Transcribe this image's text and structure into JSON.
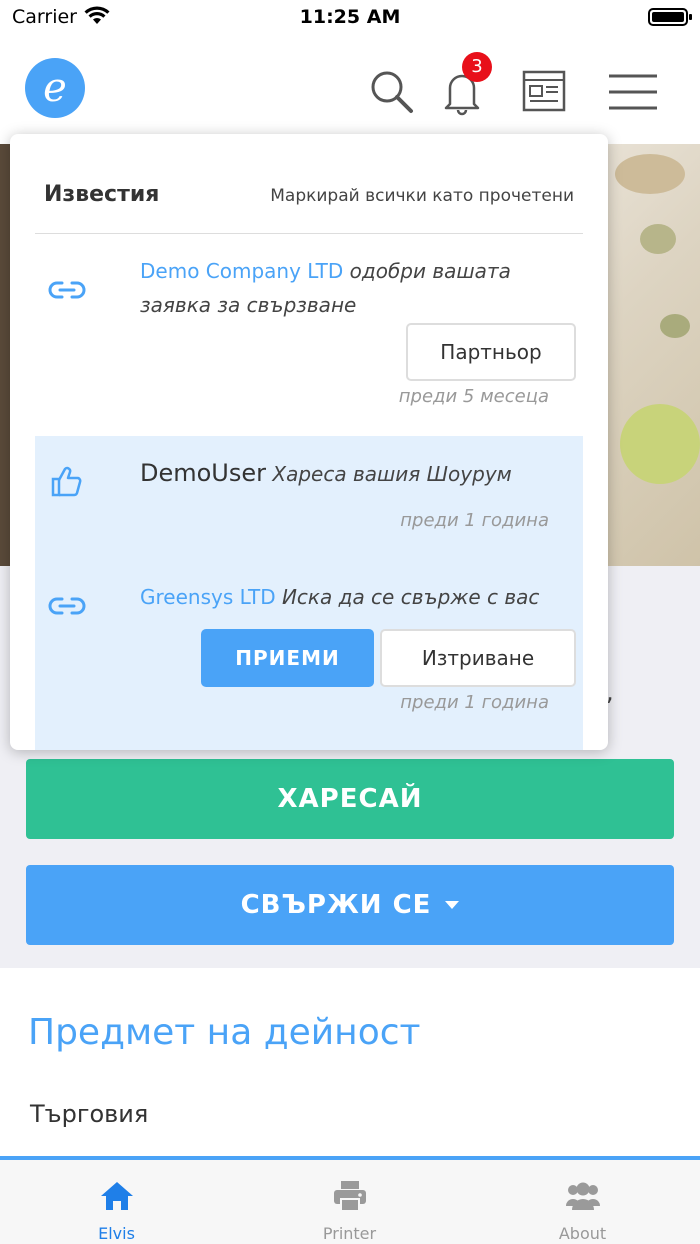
{
  "status_bar": {
    "carrier": "Carrier",
    "time": "11:25 AM"
  },
  "header": {
    "logo_letter": "e",
    "notification_count": "3"
  },
  "notifications_panel": {
    "title": "Известия",
    "mark_all_read": "Маркирай всички като прочетени",
    "items": [
      {
        "icon": "link-icon",
        "actor": "Demo Company LTD",
        "message": "одобри вашата заявка за свързване",
        "button": "Партньор",
        "time": "преди 5 месеца"
      },
      {
        "icon": "thumbs-up-icon",
        "actor": "DemoUser",
        "message": "Хареса вашия Шоурум",
        "time": "преди 1 година"
      },
      {
        "icon": "link-icon",
        "actor": "Greensys LTD",
        "message": "Иска да се свърже с вас",
        "accept_button": "ПРИЕМИ",
        "delete_button": "Изтриване",
        "time": "преди 1 година"
      }
    ]
  },
  "page": {
    "cut_text": ",",
    "like_button": "ХАРЕСАЙ",
    "connect_button": "СВЪРЖИ СЕ",
    "section_title": "Предмет на дейност",
    "section_text": "Търговия"
  },
  "tabbar": {
    "tabs": [
      {
        "label": "Elvis",
        "icon": "home-icon",
        "active": true
      },
      {
        "label": "Printer",
        "icon": "printer-icon",
        "active": false
      },
      {
        "label": "About",
        "icon": "users-icon",
        "active": false
      }
    ]
  },
  "colors": {
    "accent": "#4aa3f7",
    "like": "#2fc194",
    "badge": "#e8101a",
    "highlight": "#e3f0fd"
  }
}
